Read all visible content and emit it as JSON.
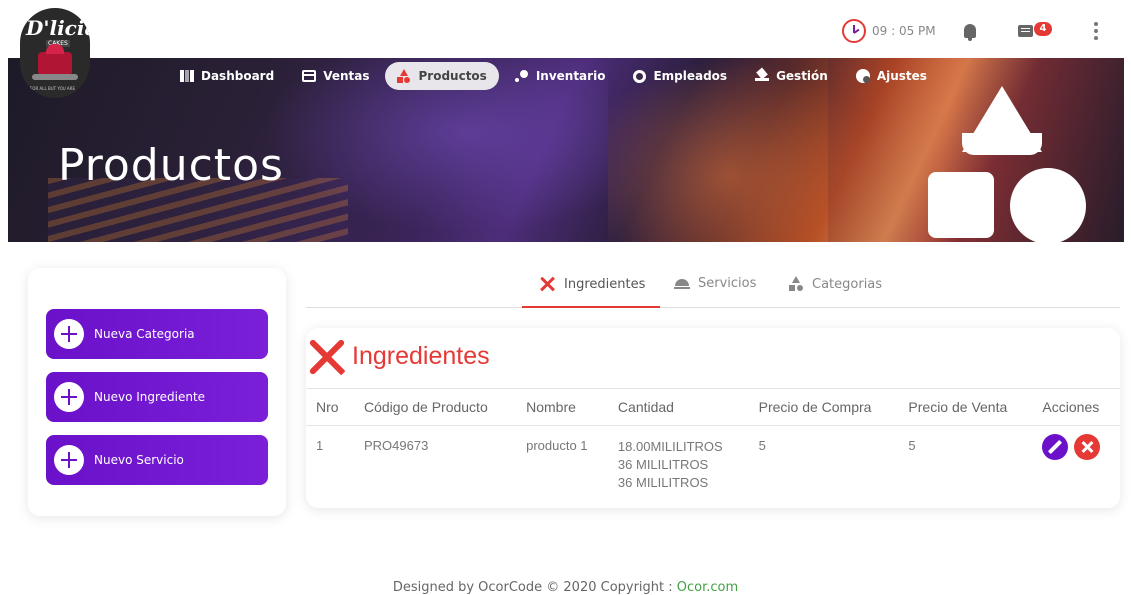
{
  "brand": {
    "logo_text": "D'licias",
    "logo_sub": "CAKES",
    "logo_motto": "FOR ALL BUT YOU ARE"
  },
  "topbar": {
    "time": "09 : 05 PM",
    "message_count": "4"
  },
  "nav": {
    "items": [
      {
        "label": "Dashboard",
        "icon": "dashboard-icon",
        "active": false
      },
      {
        "label": "Ventas",
        "icon": "card-icon",
        "active": false
      },
      {
        "label": "Productos",
        "icon": "shapes-icon",
        "active": true
      },
      {
        "label": "Inventario",
        "icon": "inventory-icon",
        "active": false
      },
      {
        "label": "Empleados",
        "icon": "employees-icon",
        "active": false
      },
      {
        "label": "Gestión",
        "icon": "layers-icon",
        "active": false
      },
      {
        "label": "Ajustes",
        "icon": "settings-icon",
        "active": false
      }
    ]
  },
  "banner": {
    "title": "Productos"
  },
  "sidebar": {
    "buttons": [
      {
        "label": "Nueva Categoria"
      },
      {
        "label": "Nuevo Ingrediente"
      },
      {
        "label": "Nuevo Servicio"
      }
    ]
  },
  "tabs": [
    {
      "label": "Ingredientes",
      "icon": "spoon-fork-icon",
      "active": true
    },
    {
      "label": "Servicios",
      "icon": "cloche-icon",
      "active": false
    },
    {
      "label": "Categorias",
      "icon": "shapes-icon",
      "active": false
    }
  ],
  "card": {
    "title": "Ingredientes",
    "columns": [
      "Nro",
      "Código de Producto",
      "Nombre",
      "Cantidad",
      "Precio de Compra",
      "Precio de Venta",
      "Acciones"
    ],
    "rows": [
      {
        "nro": "1",
        "code": "PRO49673",
        "name": "producto 1",
        "qty": [
          "18.00MILILITROS",
          "36 MILILITROS",
          "36 MILILITROS"
        ],
        "buy": "5",
        "sell": "5"
      }
    ]
  },
  "footer": {
    "text": "Designed by OcorCode © 2020 Copyright : ",
    "link": "Ocor.com"
  },
  "colors": {
    "accent_purple": "#6a11c9",
    "accent_red": "#e53935",
    "footer_link": "#43a047"
  }
}
